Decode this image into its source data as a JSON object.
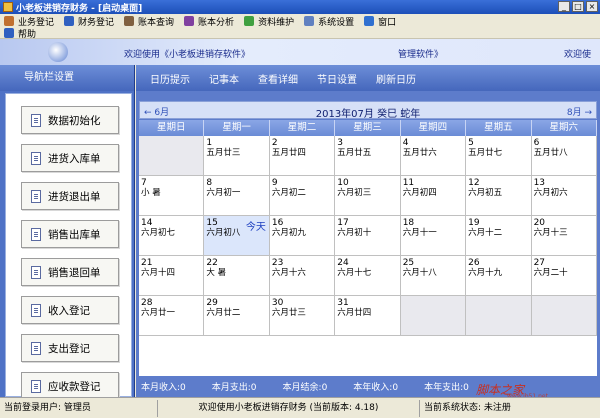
{
  "window": {
    "title": "小老板进销存财务 - [启动桌面]"
  },
  "menu": [
    {
      "label": "业务登记",
      "icon": "person-icon",
      "color": "#c07030"
    },
    {
      "label": "财务登记",
      "icon": "ledger-icon",
      "color": "#3060c0"
    },
    {
      "label": "账本查询",
      "icon": "book-icon",
      "color": "#806040"
    },
    {
      "label": "账本分析",
      "icon": "chart-icon",
      "color": "#8040a0"
    },
    {
      "label": "资料维护",
      "icon": "folder-icon",
      "color": "#40a040"
    },
    {
      "label": "系统设置",
      "icon": "settings-icon",
      "color": "#6080c0"
    },
    {
      "label": "窗口",
      "icon": "window-icon",
      "color": "#3070d0"
    }
  ],
  "menu2": [
    {
      "label": "帮助",
      "icon": "help-icon",
      "color": "#3060c0"
    }
  ],
  "banner": {
    "welcome": "欢迎使用《小老板进销存软件》",
    "center": "管理软件》",
    "right": "欢迎使"
  },
  "sidebar": {
    "title": "导航栏设置",
    "buttons": [
      "数据初始化",
      "进货入库单",
      "进货退出单",
      "销售出库单",
      "销售退回单",
      "收入登记",
      "支出登记",
      "应收款登记"
    ]
  },
  "tabs": [
    "日历提示",
    "记事本",
    "查看详细",
    "节日设置",
    "刷新日历"
  ],
  "calendar": {
    "prev": "← 6月",
    "next": "8月 →",
    "month_title": "2013年07月  癸巳 蛇年",
    "weekdays": [
      "星期日",
      "星期一",
      "星期二",
      "星期三",
      "星期四",
      "星期五",
      "星期六"
    ],
    "today_label": "今天",
    "cells": [
      {
        "day": "",
        "lunar": ""
      },
      {
        "day": "1",
        "lunar": "五月廿三"
      },
      {
        "day": "2",
        "lunar": "五月廿四"
      },
      {
        "day": "3",
        "lunar": "五月廿五"
      },
      {
        "day": "4",
        "lunar": "五月廿六"
      },
      {
        "day": "5",
        "lunar": "五月廿七"
      },
      {
        "day": "6",
        "lunar": "五月廿八"
      },
      {
        "day": "7",
        "lunar": "小 暑"
      },
      {
        "day": "8",
        "lunar": "六月初一"
      },
      {
        "day": "9",
        "lunar": "六月初二"
      },
      {
        "day": "10",
        "lunar": "六月初三"
      },
      {
        "day": "11",
        "lunar": "六月初四"
      },
      {
        "day": "12",
        "lunar": "六月初五"
      },
      {
        "day": "13",
        "lunar": "六月初六"
      },
      {
        "day": "14",
        "lunar": "六月初七"
      },
      {
        "day": "15",
        "lunar": "六月初八",
        "today": true
      },
      {
        "day": "16",
        "lunar": "六月初九"
      },
      {
        "day": "17",
        "lunar": "六月初十"
      },
      {
        "day": "18",
        "lunar": "六月十一"
      },
      {
        "day": "19",
        "lunar": "六月十二"
      },
      {
        "day": "20",
        "lunar": "六月十三"
      },
      {
        "day": "21",
        "lunar": "六月十四"
      },
      {
        "day": "22",
        "lunar": "大 暑"
      },
      {
        "day": "23",
        "lunar": "六月十六"
      },
      {
        "day": "24",
        "lunar": "六月十七"
      },
      {
        "day": "25",
        "lunar": "六月十八"
      },
      {
        "day": "26",
        "lunar": "六月十九"
      },
      {
        "day": "27",
        "lunar": "六月二十"
      },
      {
        "day": "28",
        "lunar": "六月廿一"
      },
      {
        "day": "29",
        "lunar": "六月廿二"
      },
      {
        "day": "30",
        "lunar": "六月廿三"
      },
      {
        "day": "31",
        "lunar": "六月廿四"
      },
      {
        "day": "",
        "lunar": ""
      },
      {
        "day": "",
        "lunar": ""
      },
      {
        "day": "",
        "lunar": ""
      }
    ]
  },
  "stats": [
    "本月收入:0",
    "本月支出:0",
    "本月结余:0",
    "本年收入:0",
    "本年支出:0"
  ],
  "watermark": {
    "text": "脚本之家",
    "url": "www.jb51.net"
  },
  "status": {
    "user": "当前登录用户: 管理员",
    "welcome": "欢迎使用小老板进销存财务    (当前版本: 4.18)",
    "system": "当前系统状态: 未注册"
  }
}
